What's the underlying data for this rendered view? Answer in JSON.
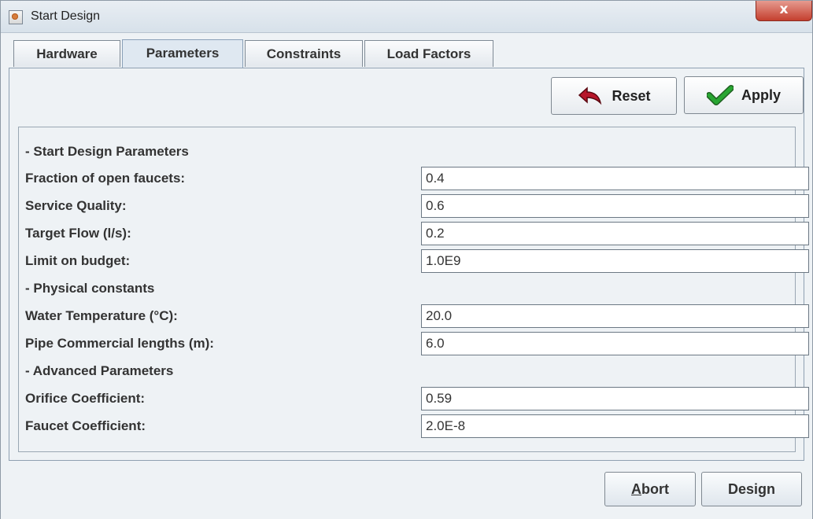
{
  "window": {
    "title": "Start Design",
    "close_glyph": "x"
  },
  "tabs": [
    {
      "label": "Hardware"
    },
    {
      "label": "Parameters"
    },
    {
      "label": "Constraints"
    },
    {
      "label": "Load Factors"
    }
  ],
  "toolbar": {
    "reset_label": "Reset",
    "apply_label": "Apply",
    "reset_icon": "undo-arrow-icon",
    "apply_icon": "checkmark-icon",
    "accent_red": "#b7162a",
    "accent_green": "#28a632"
  },
  "form": {
    "sections": [
      {
        "title": "- Start Design Parameters",
        "fields": [
          {
            "label": "Fraction of open faucets:",
            "value": "0.4"
          },
          {
            "label": "Service Quality:",
            "value": "0.6"
          },
          {
            "label": "Target Flow (l/s):",
            "value": "0.2"
          },
          {
            "label": "Limit on budget:",
            "value": "1.0E9"
          }
        ]
      },
      {
        "title": "- Physical constants",
        "fields": [
          {
            "label": "Water Temperature (°C):",
            "value": "20.0"
          },
          {
            "label": "Pipe Commercial lengths (m):",
            "value": "6.0"
          }
        ]
      },
      {
        "title": "- Advanced Parameters",
        "fields": [
          {
            "label": "Orifice Coefficient:",
            "value": "0.59"
          },
          {
            "label": "Faucet Coefficient:",
            "value": "2.0E-8"
          }
        ]
      }
    ]
  },
  "footer": {
    "abort_label": "Abort",
    "design_label": "Design"
  }
}
